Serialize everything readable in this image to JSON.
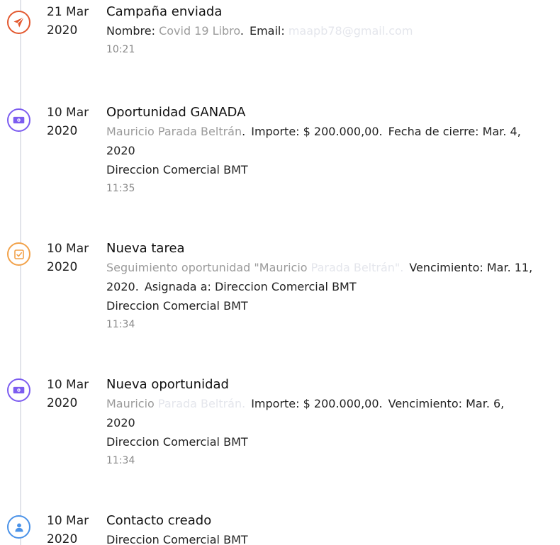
{
  "colors": {
    "red": "#e3582f",
    "purple": "#7c5cf0",
    "orange": "#f2a24a",
    "blue": "#4a92e8"
  },
  "events": [
    {
      "icon": "paper-plane-icon",
      "day": "21 Mar",
      "year": "2020",
      "title": "Campaña enviada",
      "name_label": "Nombre:",
      "name_value": "Covid 19 Libro",
      "email_label": "Email:",
      "email_value": "maapb78@gmail.com",
      "time": "10:21"
    },
    {
      "icon": "money-icon",
      "day": "10 Mar",
      "year": "2020",
      "title": "Oportunidad GANADA",
      "contact": "Mauricio Parada Beltrán",
      "amount_label": "Importe:",
      "amount_value": "$ 200.000,00.",
      "close_label": "Fecha de cierre:",
      "close_value": "Mar. 4,",
      "close_year": "2020",
      "owner": "Direccion Comercial BMT",
      "time": "11:35"
    },
    {
      "icon": "task-check-icon",
      "day": "10 Mar",
      "year": "2020",
      "title": "Nueva tarea",
      "task_prefix": "Seguimiento oportunidad \"Mauricio ",
      "task_faded": "Parada Beltrán\".",
      "due_label": "Vencimiento:",
      "due_value": "Mar. 11,",
      "due_year": "2020.",
      "assigned_label": "Asignada a:",
      "assigned_value": "Direccion Comercial BMT",
      "owner": "Direccion Comercial BMT",
      "time": "11:34"
    },
    {
      "icon": "money-icon",
      "day": "10 Mar",
      "year": "2020",
      "title": "Nueva oportunidad",
      "contact_prefix": "Mauricio ",
      "contact_faded": "Parada Beltrán.",
      "amount_label": "Importe:",
      "amount_value": "$ 200.000,00.",
      "due_label": "Vencimiento:",
      "due_value": "Mar. 6,",
      "due_year": "2020",
      "owner": "Direccion Comercial BMT",
      "time": "11:34"
    },
    {
      "icon": "user-icon",
      "day": "10 Mar",
      "year": "2020",
      "title": "Contacto creado",
      "owner": "Direccion Comercial BMT"
    }
  ]
}
